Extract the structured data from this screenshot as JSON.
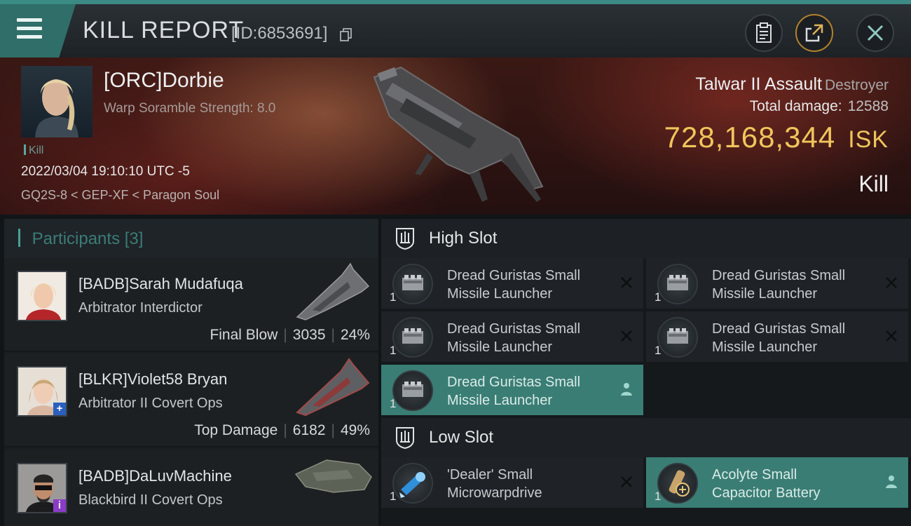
{
  "header": {
    "title": "KILL REPORT",
    "report_id": "[ID:6853691]"
  },
  "victim": {
    "name": "[ORC]Dorbie",
    "warp_scramble": "Warp Soramble Strength: 8.0",
    "kill_tag": "Kill",
    "datetime": "2022/03/04 19:10:10 UTC -5",
    "location": "GQ2S-8 < GEP-XF < Paragon Soul"
  },
  "ship": {
    "name": "Talwar II Assault",
    "class": "Destroyer",
    "total_damage_label": "Total damage:",
    "total_damage": "12588",
    "isk_value": "728,168,344",
    "isk_unit": "ISK",
    "result": "Kill"
  },
  "participants": {
    "title": "Participants",
    "count": "[3]",
    "items": [
      {
        "name": "[BADB]Sarah Mudafuqa",
        "ship": "Arbitrator Interdictor",
        "role": "Final Blow",
        "damage": "3035",
        "percent": "24%"
      },
      {
        "name": "[BLKR]Violet58 Bryan",
        "ship": "Arbitrator II Covert Ops",
        "role": "Top Damage",
        "damage": "6182",
        "percent": "49%",
        "badge": "+"
      },
      {
        "name": "[BADB]DaLuvMachine",
        "ship": "Blackbird II Covert Ops",
        "badge": "i"
      }
    ]
  },
  "slots": {
    "high_title": "High Slot",
    "low_title": "Low Slot",
    "high": [
      {
        "line1": "Dread Guristas Small",
        "line2": "Missile Launcher",
        "qty": "1",
        "state": "destroyed"
      },
      {
        "line1": "Dread Guristas Small",
        "line2": "Missile Launcher",
        "qty": "1",
        "state": "destroyed"
      },
      {
        "line1": "Dread Guristas Small",
        "line2": "Missile Launcher",
        "qty": "1",
        "state": "destroyed"
      },
      {
        "line1": "Dread Guristas Small",
        "line2": "Missile Launcher",
        "qty": "1",
        "state": "destroyed"
      },
      {
        "line1": "Dread Guristas Small",
        "line2": "Missile Launcher",
        "qty": "1",
        "state": "dropped"
      }
    ],
    "low": [
      {
        "line1": "'Dealer' Small",
        "line2": "Microwarpdrive",
        "qty": "1",
        "state": "destroyed"
      },
      {
        "line1": "Acolyte Small",
        "line2": "Capacitor Battery",
        "qty": "1",
        "state": "dropped"
      }
    ]
  },
  "colors": {
    "accent_teal": "#3a7d74",
    "isk_gold": "#f0c55c",
    "hero_red": "#3a1814"
  }
}
